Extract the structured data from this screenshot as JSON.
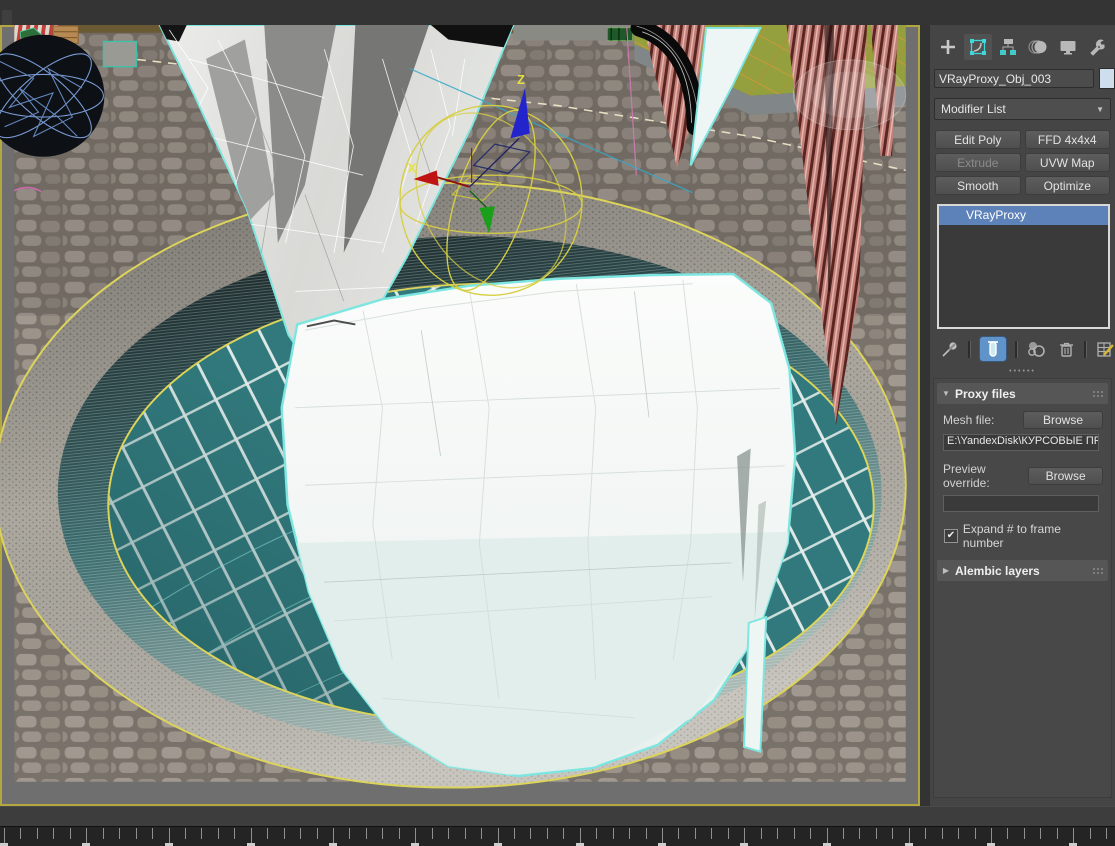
{
  "command_panel": {
    "tabs": [
      {
        "name": "create",
        "icon": "plus-icon"
      },
      {
        "name": "modify",
        "icon": "modify-icon",
        "active": true
      },
      {
        "name": "hierarchy",
        "icon": "hierarchy-icon"
      },
      {
        "name": "motion",
        "icon": "motion-icon"
      },
      {
        "name": "display",
        "icon": "display-icon"
      },
      {
        "name": "utilities",
        "icon": "wrench-icon"
      }
    ],
    "object_name": "VRayProxy_Obj_003",
    "object_color_swatch": "#cfdeed",
    "modifier_list_label": "Modifier List",
    "modifier_buttons": [
      {
        "label": "Edit Poly",
        "enabled": true
      },
      {
        "label": "FFD 4x4x4",
        "enabled": true
      },
      {
        "label": "Extrude",
        "enabled": false
      },
      {
        "label": "UVW Map",
        "enabled": true
      },
      {
        "label": "Smooth",
        "enabled": true
      },
      {
        "label": "Optimize",
        "enabled": true
      }
    ],
    "modifier_stack": {
      "items": [
        {
          "label": "VRayProxy",
          "selected": true
        }
      ],
      "selected_color": "#5d82ba"
    },
    "stack_tools": [
      "pin-stack",
      "show-end-result",
      "make-unique",
      "remove-modifier",
      "configure-modifier-sets"
    ],
    "rollouts": {
      "proxy_files": {
        "title": "Proxy files",
        "mesh_file_label": "Mesh file:",
        "mesh_browse_label": "Browse",
        "mesh_file_path": "E:\\YandexDisk\\КУРСОВЫЕ ПРОЕКТЫ",
        "preview_override_label": "Preview override:",
        "preview_browse_label": "Browse",
        "preview_override_value": "",
        "expand_checkbox_label": "Expand # to frame number",
        "expand_checked": true
      },
      "alembic_layers": {
        "title": "Alembic layers",
        "collapsed": true
      }
    }
  },
  "viewport": {
    "axis_labels": {
      "x": "X",
      "z": "Z"
    },
    "selected_object": "VRayProxy_Obj_003",
    "colors": {
      "selection_outline": "#7ee6e0",
      "spline_yellow": "#ddd45a",
      "pool_teal": "#31797c",
      "gizmo_x": "#c01414",
      "gizmo_y": "#18a018",
      "gizmo_z": "#2424cc",
      "gizmo_sphere": "#d6ce42",
      "active_viewport_border": "#b3a83f"
    }
  },
  "timeline": {
    "has_track_bar": true
  }
}
